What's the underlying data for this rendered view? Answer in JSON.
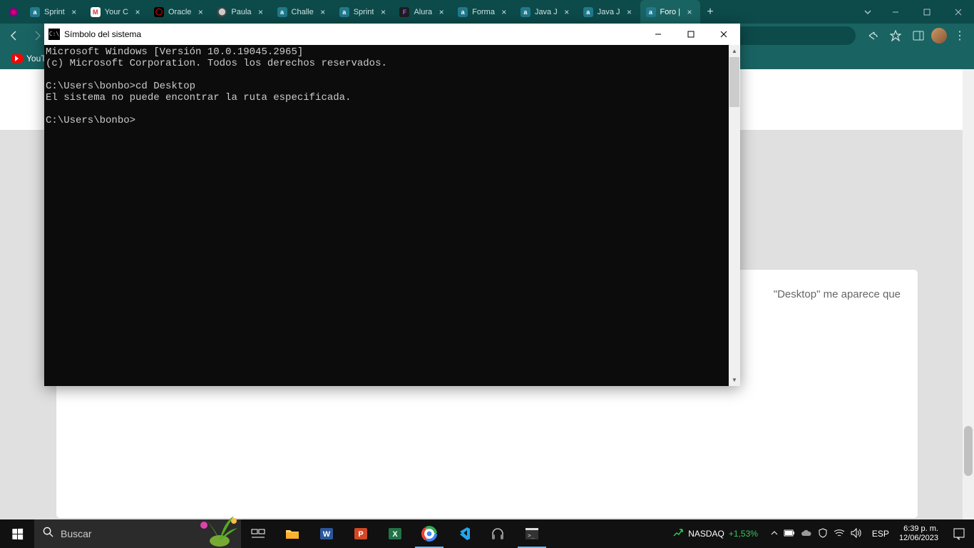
{
  "tabs": [
    {
      "label": "",
      "fav": "dot"
    },
    {
      "label": "Sprint",
      "fav": "a"
    },
    {
      "label": "Your C",
      "fav": "m"
    },
    {
      "label": "Oracle",
      "fav": "o"
    },
    {
      "label": "Paula",
      "fav": "p"
    },
    {
      "label": "Challe",
      "fav": "a"
    },
    {
      "label": "Sprint",
      "fav": "a"
    },
    {
      "label": "Alura",
      "fav": "fg"
    },
    {
      "label": "Forma",
      "fav": "a"
    },
    {
      "label": "Java J",
      "fav": "a"
    },
    {
      "label": "Java J",
      "fav": "a"
    },
    {
      "label": "Foro |",
      "fav": "a"
    }
  ],
  "active_tab_index": 11,
  "bookmarks": [
    {
      "label": "YouTube"
    }
  ],
  "page": {
    "card_text_fragment": "\"Desktop\" me aparece que"
  },
  "cmd": {
    "title": "Símbolo del sistema",
    "line1": "Microsoft Windows [Versión 10.0.19045.2965]",
    "line2": "(c) Microsoft Corporation. Todos los derechos reservados.",
    "blank1": "",
    "line3": "C:\\Users\\bonbo>cd Desktop",
    "line4": "El sistema no puede encontrar la ruta especificada.",
    "blank2": "",
    "line5": "C:\\Users\\bonbo>"
  },
  "taskbar": {
    "search_placeholder": "Buscar",
    "news_label": "NASDAQ",
    "news_value": "+1,53%",
    "lang": "ESP",
    "time": "6:39 p. m.",
    "date": "12/06/2023"
  }
}
